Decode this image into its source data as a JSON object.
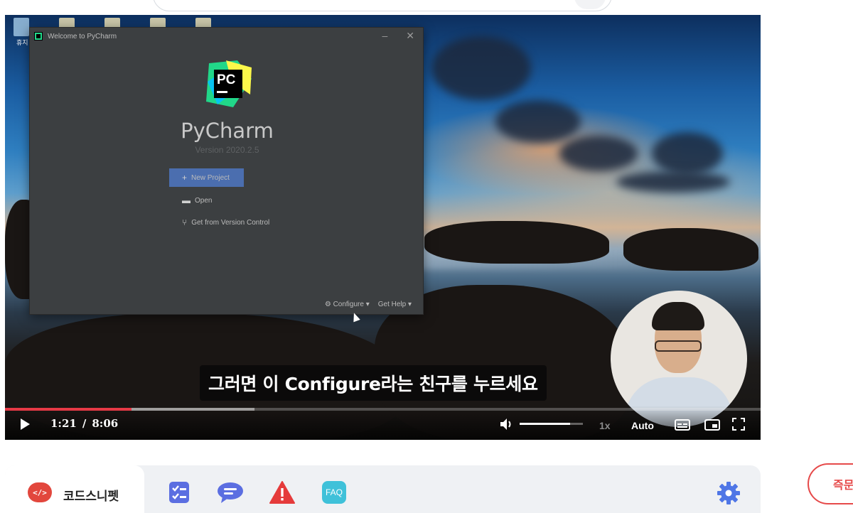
{
  "video": {
    "desktop_label": "휴지",
    "ide_window": {
      "title": "Welcome to PyCharm",
      "app_name": "PyCharm",
      "version": "Version 2020.2.5",
      "logo_text": "PC",
      "actions": [
        {
          "icon": "plus-icon",
          "label": "New Project"
        },
        {
          "icon": "folder-icon",
          "label": "Open"
        },
        {
          "icon": "vcs-icon",
          "label": "Get from Version Control"
        }
      ],
      "footer": {
        "configure": "Configure ▾",
        "get_help": "Get Help ▾"
      }
    },
    "subtitle": "그러면 이 Configure라는 친구를 누르세요",
    "controls": {
      "current_time": "1:21",
      "separator": "/",
      "duration": "8:06",
      "played_fraction": 0.167,
      "buffered_fraction": 0.33,
      "volume_fraction": 0.8,
      "speed": "1x",
      "quality": "Auto"
    }
  },
  "tabs": {
    "active_label": "코드스니펫",
    "snippet_icon_text": "</>",
    "faq_label": "FAQ"
  },
  "side_button": {
    "label": "즉문"
  },
  "colors": {
    "accent_red": "#e63946",
    "tab_blue": "#5b6ee1",
    "faq_teal": "#3fc1d9",
    "warning_red": "#e53b3b",
    "gear_blue": "#4f76e6"
  }
}
